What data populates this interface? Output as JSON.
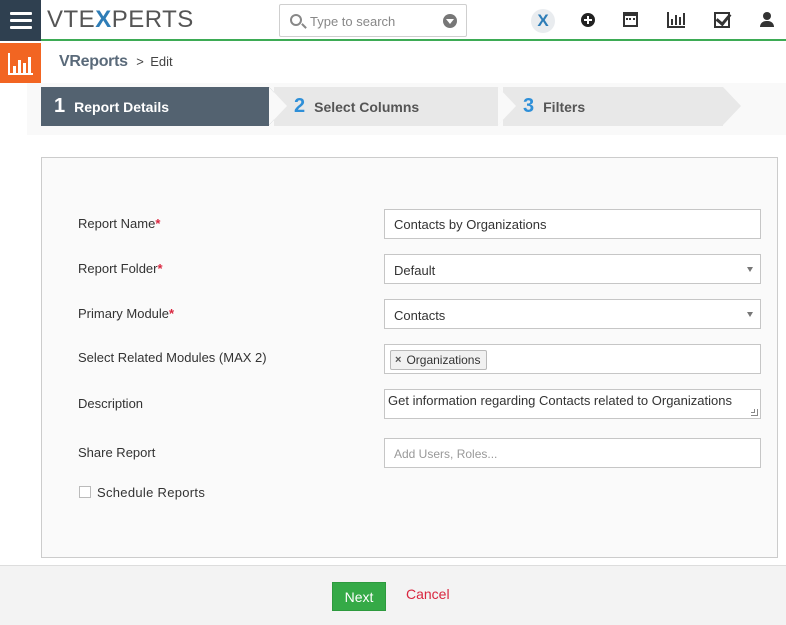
{
  "header": {
    "logo_left": "VTE",
    "logo_x": "X",
    "logo_right": "PERTS",
    "search_placeholder": "Type to search",
    "icons": [
      "menu-icon",
      "vtexperts-x-icon",
      "plus-icon",
      "calendar-icon",
      "chart-icon",
      "checkbox-icon",
      "user-icon"
    ]
  },
  "breadcrumb": {
    "module": "VReports",
    "separator": ">",
    "page": "Edit"
  },
  "steps": [
    {
      "number": "1",
      "label": "Report Details",
      "active": true
    },
    {
      "number": "2",
      "label": "Select Columns",
      "active": false
    },
    {
      "number": "3",
      "label": "Filters",
      "active": false
    }
  ],
  "form": {
    "report_name": {
      "label": "Report Name",
      "required": "*",
      "value": "Contacts by Organizations"
    },
    "report_folder": {
      "label": "Report Folder",
      "required": "*",
      "value": "Default"
    },
    "primary_module": {
      "label": "Primary Module",
      "required": "*",
      "value": "Contacts"
    },
    "related_modules": {
      "label": "Select Related Modules (MAX 2)",
      "tag_remove": "×",
      "tag": "Organizations"
    },
    "description": {
      "label": "Description",
      "value": "Get information regarding Contacts related to Organizations"
    },
    "share_report": {
      "label": "Share Report",
      "placeholder": "Add Users, Roles..."
    },
    "schedule": {
      "label": "Schedule Reports",
      "checked": false
    }
  },
  "footer": {
    "next_label": "Next",
    "cancel_label": "Cancel"
  },
  "colors": {
    "accent_green": "#35aa47",
    "module_orange": "#f26522",
    "step_active": "#536270",
    "step_number_blue": "#2e8fd8",
    "required_red": "#d9263f"
  }
}
